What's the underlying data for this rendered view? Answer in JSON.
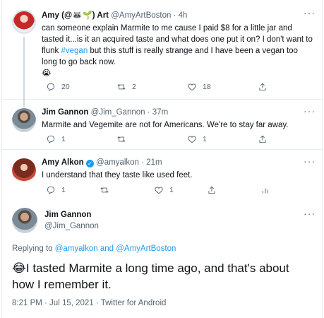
{
  "tweets": [
    {
      "name": "Amy (@🦝🌱) Art",
      "handle": "@AmyArtBoston",
      "time": "· 4h",
      "text_before": "can someone explain Marmite  to me cause I paid $8 for a little jar and tasted it...is it an acquired taste and what does one put it on? I don't want to flunk ",
      "hashtag": "#vegan",
      "text_after": " but this stuff is really strange and I have been a vegan too long to go back now.",
      "emoji": "😭",
      "replies": "20",
      "retweets": "2",
      "likes": "18"
    },
    {
      "name": "Jim Gannon",
      "handle": "@Jim_Gannon",
      "time": "· 37m",
      "text": "Marmite and Vegemite are not for Americans. We're to stay far away.",
      "replies": "1",
      "likes": "1"
    },
    {
      "name": "Amy Alkon",
      "handle": "@amyalkon",
      "time": "· 21m",
      "text": "I understand that they taste like used feet.",
      "replies": "1",
      "likes": "1"
    }
  ],
  "main_tweet": {
    "name": "Jim Gannon",
    "handle": "@Jim_Gannon",
    "replying_label": "Replying to",
    "replying_to_1": "@amyalkon",
    "replying_and": "and",
    "replying_to_2": "@AmyArtBoston",
    "emoji": "😂",
    "text": "I tasted Marmite a long time ago, and that's about how I remember it.",
    "timestamp": "8:21 PM · Jul 15, 2021 · Twitter for Android"
  },
  "icons": {
    "reply": "reply-icon",
    "retweet": "retweet-icon",
    "like": "heart-icon",
    "share": "share-icon",
    "analytics": "analytics-icon",
    "more": "more-options-icon",
    "verified": "verified-badge-icon"
  },
  "colors": {
    "link": "#1d9bf0",
    "muted": "#536471",
    "border": "#e6ecf0"
  },
  "more_glyph": "···",
  "verified_glyph": "✓"
}
